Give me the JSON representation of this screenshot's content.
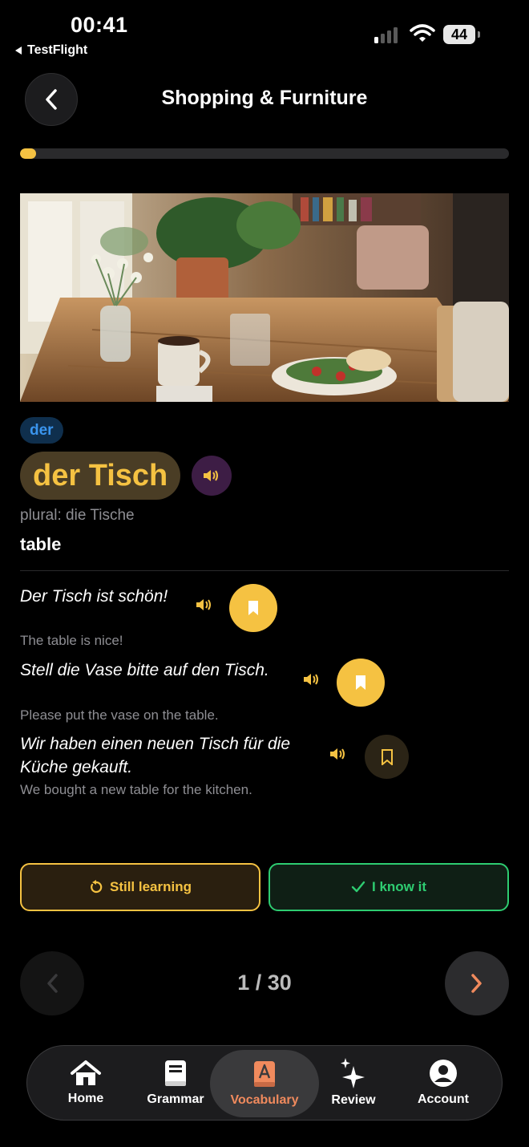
{
  "status_bar": {
    "time": "00:41",
    "back_app": "TestFlight",
    "battery": "44"
  },
  "header": {
    "title": "Shopping & Furniture"
  },
  "progress": {
    "fraction": 0.033
  },
  "card": {
    "image_alt": "Wooden kitchen table with flowers, coffee cup, water glass and salad",
    "article": "der",
    "word": "der Tisch",
    "plural": "plural: die Tische",
    "meaning": "table",
    "examples": [
      {
        "de": "Der Tisch ist schön!",
        "en": "The table is nice!",
        "bookmarked": true
      },
      {
        "de": "Stell die Vase bitte auf den Tisch.",
        "en": "Please put the vase on the table.",
        "bookmarked": true
      },
      {
        "de": "Wir haben einen neuen Tisch für die Küche gekauft.",
        "en": "We bought a new table for the kitchen.",
        "bookmarked": false
      }
    ]
  },
  "actions": {
    "still_learning": "Still learning",
    "know_it": "I know it"
  },
  "pager": {
    "count": "1 / 30"
  },
  "tabs": [
    {
      "label": "Home",
      "icon": "home-icon"
    },
    {
      "label": "Grammar",
      "icon": "book-icon"
    },
    {
      "label": "Vocabulary",
      "icon": "vocabulary-book-icon",
      "active": true
    },
    {
      "label": "Review",
      "icon": "sparkles-icon"
    },
    {
      "label": "Account",
      "icon": "account-icon"
    }
  ],
  "colors": {
    "accent_yellow": "#f5c242",
    "accent_green": "#2ecc71",
    "accent_orange": "#f08a5d",
    "article_blue": "#3a95ee"
  }
}
